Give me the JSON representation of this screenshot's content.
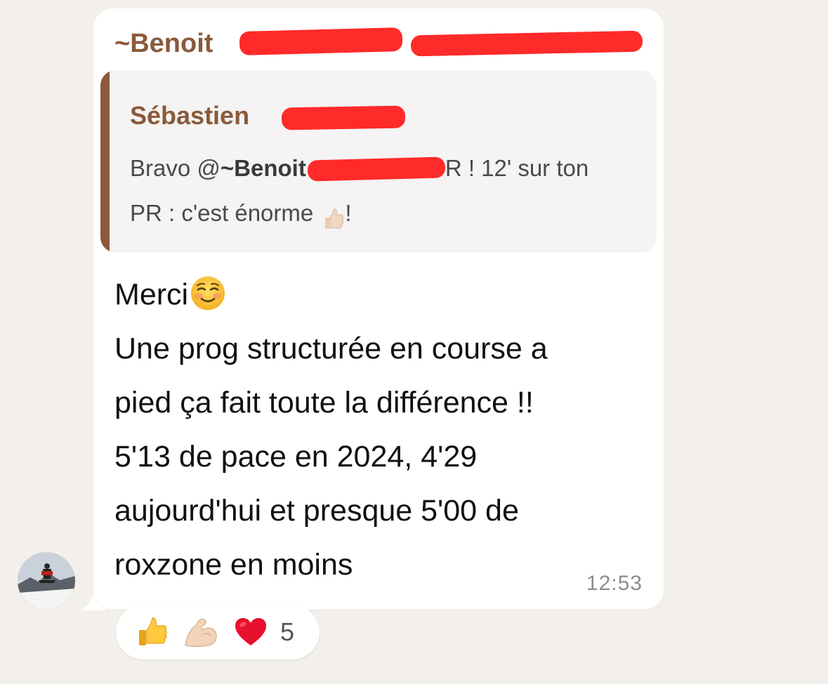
{
  "message": {
    "sender": "~Benoit",
    "quoted": {
      "author": "Sébastien",
      "text_part1": "Bravo @",
      "mention": "~Benoit",
      "text_part2": "R ! 12' sur ton",
      "text_part3": "PR : c'est énorme",
      "text_part4": "!",
      "emoji": "thumbs-up-icon"
    },
    "lines": {
      "l1": "Merci",
      "l2": "Une prog structurée en course a",
      "l3": "pied ça fait toute la différence !!",
      "l4": "5'13 de pace en 2024, 4'29",
      "l5": "aujourd'hui et presque 5'00 de",
      "l6": "roxzone en moins"
    },
    "emoji_after_merci": "smiling-face-icon",
    "time": "12:53"
  },
  "reactions": {
    "items": [
      "thumbs-up-icon",
      "flexed-biceps-icon",
      "red-heart-icon"
    ],
    "count": "5"
  },
  "colors": {
    "background": "#f3f0eb",
    "bubble": "#ffffff",
    "accent_brown": "#8a5a3b",
    "redaction": "#ff2a2a"
  }
}
